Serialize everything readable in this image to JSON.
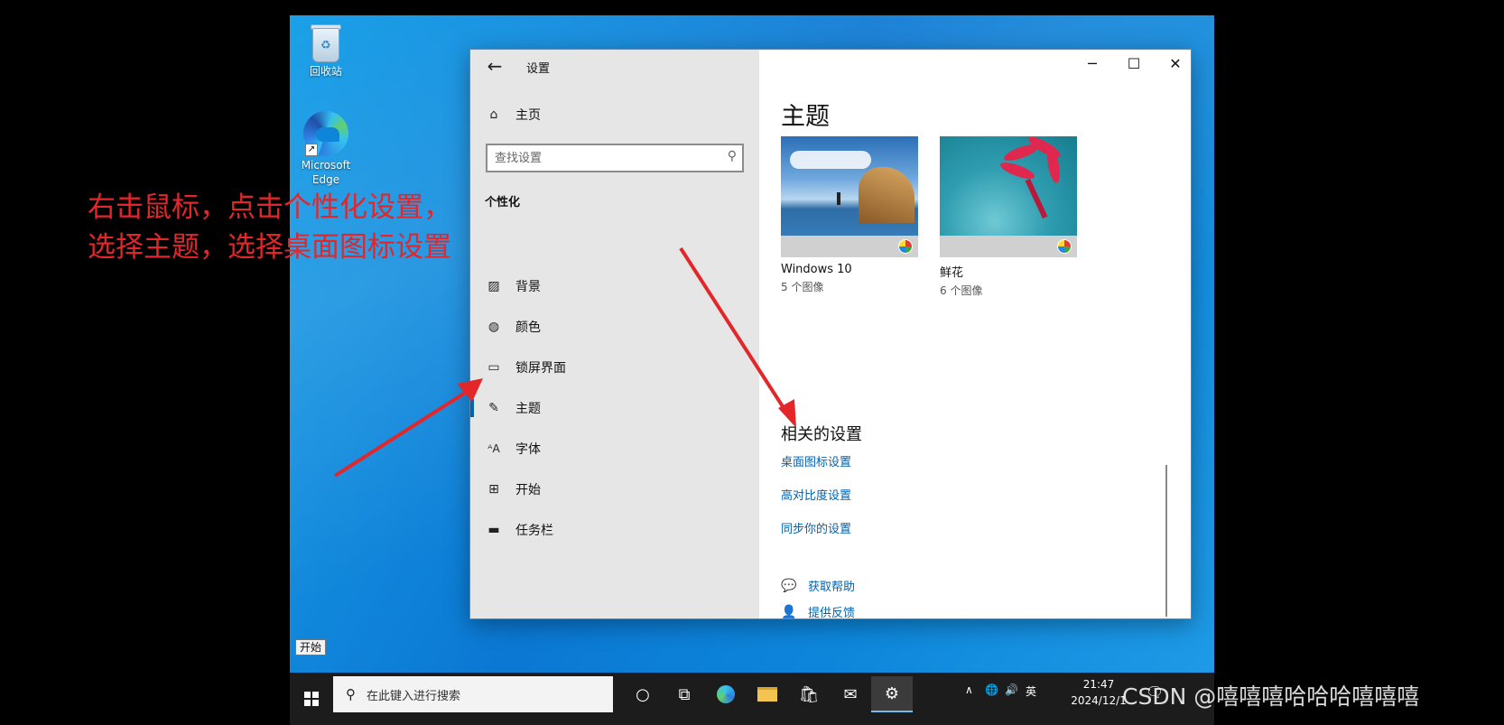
{
  "desktop": {
    "icons": [
      {
        "label": "回收站"
      },
      {
        "label": "Microsoft Edge"
      }
    ]
  },
  "window": {
    "title": "设置",
    "back_icon": "arrow-left-icon",
    "controls": {
      "minimize": "─",
      "maximize": "☐",
      "close": "✕"
    }
  },
  "nav": {
    "home": "主页",
    "search_placeholder": "查找设置",
    "section": "个性化",
    "items": [
      {
        "label": "背景",
        "icon": "image-icon"
      },
      {
        "label": "颜色",
        "icon": "palette-icon"
      },
      {
        "label": "锁屏界面",
        "icon": "lock-screen-icon"
      },
      {
        "label": "主题",
        "icon": "theme-brush-icon",
        "active": true
      },
      {
        "label": "字体",
        "icon": "font-icon"
      },
      {
        "label": "开始",
        "icon": "start-grid-icon"
      },
      {
        "label": "任务栏",
        "icon": "taskbar-icon"
      }
    ]
  },
  "content": {
    "title": "主题",
    "themes": [
      {
        "name": "Windows 10",
        "count": "5 个图像"
      },
      {
        "name": "鲜花",
        "count": "6 个图像"
      }
    ],
    "related_heading": "相关的设置",
    "links": [
      "桌面图标设置",
      "高对比度设置",
      "同步你的设置"
    ],
    "help": [
      {
        "label": "获取帮助",
        "icon": "help-chat-icon"
      },
      {
        "label": "提供反馈",
        "icon": "feedback-icon"
      }
    ]
  },
  "taskbar": {
    "tooltip": "开始",
    "search_placeholder": "在此键入进行搜索",
    "tray": {
      "lang": "英"
    },
    "time": "21:47",
    "date": "2024/12/1"
  },
  "annotation": {
    "line1": "右击鼠标，点击个性化设置，",
    "line2": "选择主题，选择桌面图标设置"
  },
  "watermark": "CSDN @嘻嘻嘻哈哈哈嘻嘻嘻",
  "colors": {
    "accent": "#0063b1",
    "annotation": "#e3262a",
    "desktop": "#0b78d3"
  }
}
